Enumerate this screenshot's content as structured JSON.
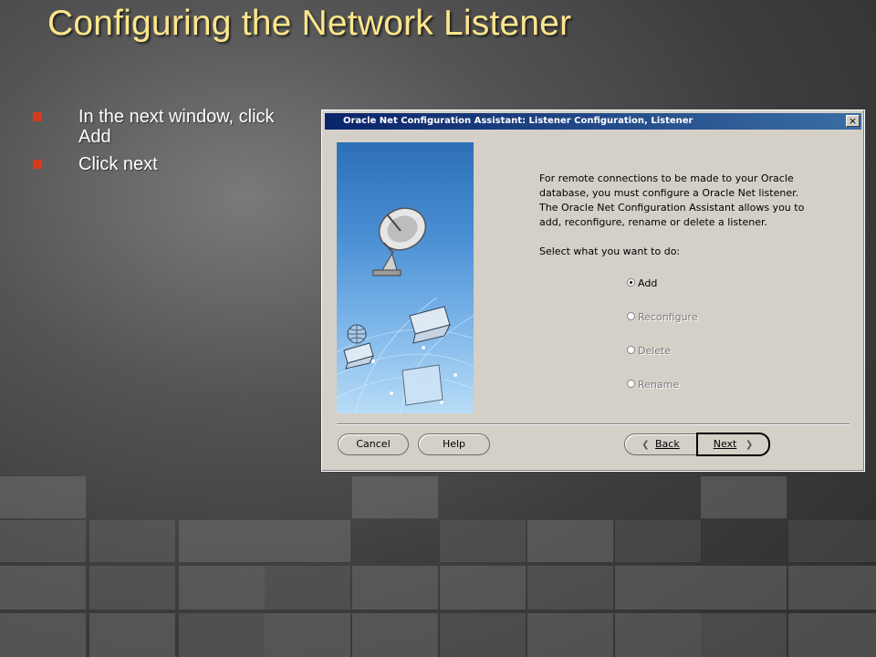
{
  "slide": {
    "title": "Configuring the Network Listener",
    "bullets": [
      "In the next window, click Add",
      "Click next"
    ]
  },
  "dialog": {
    "title": "Oracle Net Configuration Assistant: Listener Configuration, Listener",
    "close_glyph": "×",
    "intro": "For remote connections to be made to your Oracle database, you must configure a Oracle Net listener. The Oracle Net Configuration Assistant allows you to add, reconfigure, rename or delete a listener.",
    "prompt": "Select what you want to do:",
    "options": [
      {
        "label": "Add",
        "selected": true,
        "enabled": true
      },
      {
        "label": "Reconfigure",
        "selected": false,
        "enabled": false
      },
      {
        "label": "Delete",
        "selected": false,
        "enabled": false
      },
      {
        "label": "Rename",
        "selected": false,
        "enabled": false
      }
    ],
    "buttons": {
      "cancel": "Cancel",
      "help": "Help",
      "back": "Back",
      "next": "Next"
    },
    "icons": [
      "satellite-dish-icon",
      "globe-icon",
      "laptop-icon",
      "folder-icon"
    ]
  },
  "colors": {
    "title_yellow": "#fce68c",
    "bullet_red": "#d63b1c",
    "titlebar_blue": "#0a246a"
  }
}
